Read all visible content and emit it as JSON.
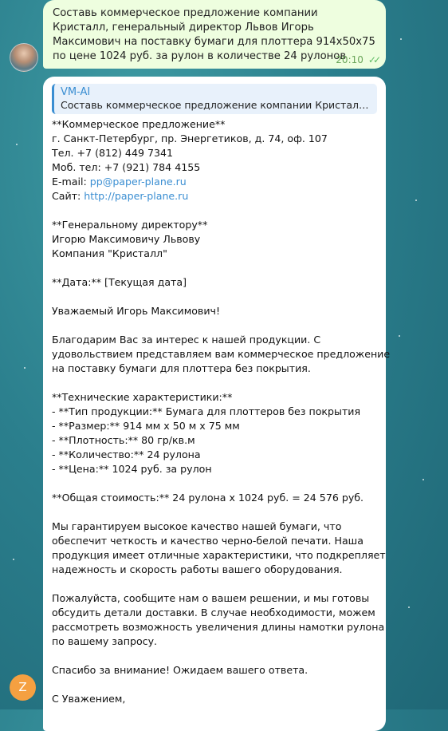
{
  "outgoing": {
    "text": "Составь коммерческое предложение компании Кристалл, генеральный директор Львов Игорь Максимович на поставку бумаги для плоттера 914х50х75 по цене 1024 руб. за рулон в количестве 24 рулонов",
    "time": "20:10",
    "status_icon": "double-check-icon"
  },
  "incoming": {
    "reply_author": "VM-AI",
    "reply_text": "Составь коммерческое предложение компании Кристалл, г...",
    "avatar_letter": "Z",
    "lines": [
      "**Коммерческое предложение**",
      "г. Санкт-Петербург, пр. Энергетиков, д. 74, оф. 107",
      "Тел. +7 (812) 449 7341",
      "Моб. тел: +7 (921) 784 4155",
      "",
      "",
      "",
      "**Генеральному директору**",
      "Игорю Максимовичу Львову",
      "Компания \"Кристалл\"",
      "",
      "**Дата:** [Текущая дата]",
      "",
      "Уважаемый Игорь Максимович!",
      "",
      "Благодарим Вас за интерес к нашей продукции. С",
      "удовольствием представляем вам коммерческое предложение",
      "на поставку бумаги для плоттера без покрытия.",
      "",
      "**Технические характеристики:**",
      "- **Тип продукции:** Бумага для плоттеров без покрытия",
      "- **Размер:** 914 мм x 50 м x 75 мм",
      "- **Плотность:** 80 гр/кв.м",
      "- **Количество:** 24 рулона",
      "- **Цена:** 1024 руб. за рулон",
      "",
      "**Общая стоимость:** 24 рулона x 1024 руб. = 24 576 руб.",
      "",
      "Мы гарантируем высокое качество нашей бумаги, что",
      "обеспечит четкость и качество черно-белой печати. Наша",
      "продукция имеет отличные характеристики, что подкрепляет",
      "надежность и скорость работы вашего оборудования.",
      "",
      "Пожалуйста, сообщите нам о вашем решении, и мы готовы",
      "обсудить детали доставки. В случае необходимости, можем",
      "рассмотреть возможность увеличения длины намотки рулона",
      "по вашему запросу.",
      "",
      "Спасибо за внимание! Ожидаем вашего ответа.",
      "",
      "С Уважением,"
    ],
    "email_label": "E-mail: ",
    "email": "pp@paper-plane.ru",
    "site_label": "Сайт: ",
    "site": "http://paper-plane.ru"
  },
  "colors": {
    "outgoing_bubble": "#eefedf",
    "incoming_bubble": "#ffffff",
    "link": "#3a8ed2",
    "avatar_z": "#f5a041"
  }
}
